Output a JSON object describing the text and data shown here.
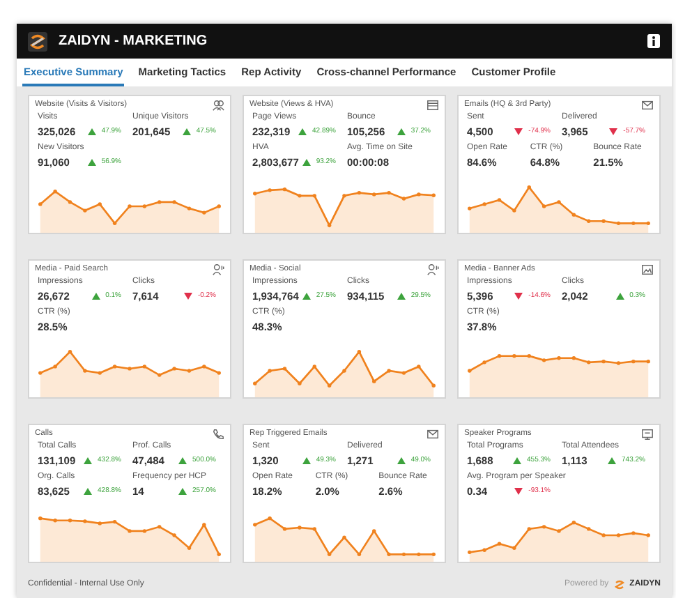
{
  "header": {
    "title": "ZAIDYN - MARKETING"
  },
  "tabs": [
    {
      "label": "Executive Summary",
      "selected": true
    },
    {
      "label": "Marketing Tactics",
      "selected": false
    },
    {
      "label": "Rep Activity",
      "selected": false
    },
    {
      "label": "Cross-channel Performance",
      "selected": false
    },
    {
      "label": "Customer Profile",
      "selected": false
    }
  ],
  "cards": [
    {
      "title": "Website (Visits & Visitors)",
      "rows": [
        {
          "metrics": [
            {
              "label": "Visits",
              "value": "325,026",
              "delta": "47.9%",
              "rising": true
            },
            {
              "label": "Unique Visitors",
              "value": "201,645",
              "delta": "47.5%",
              "rising": true
            }
          ]
        },
        {
          "metrics": [
            {
              "label": "New Visitors",
              "value": "91,060",
              "delta": "56.9%",
              "rising": true
            }
          ]
        }
      ]
    },
    {
      "title": "Website (Views & HVA)",
      "rows": [
        {
          "metrics": [
            {
              "label": "Page Views",
              "value": "232,319",
              "delta": "42.89%",
              "rising": true
            },
            {
              "label": "Bounce",
              "value": "105,256",
              "delta": "37.2%",
              "rising": true
            }
          ]
        },
        {
          "metrics": [
            {
              "label": "HVA",
              "value": "2,803,677",
              "delta": "93.2%",
              "rising": true
            },
            {
              "label": "Avg. Time on Site",
              "value": "00:00:08"
            }
          ]
        }
      ]
    },
    {
      "title": "Emails (HQ & 3rd Party)",
      "rows": [
        {
          "metrics": [
            {
              "label": "Sent",
              "value": "4,500",
              "delta": "-74.9%",
              "rising": false
            },
            {
              "label": "Delivered",
              "value": "3,965",
              "delta": "-57.7%",
              "rising": false
            }
          ]
        },
        {
          "metrics": [
            {
              "label": "Open Rate",
              "value": "84.6%"
            },
            {
              "label": "CTR (%)",
              "value": "64.8%"
            },
            {
              "label": "Bounce Rate",
              "value": "21.5%"
            }
          ]
        }
      ]
    },
    {
      "title": "Media - Paid Search",
      "rows": [
        {
          "metrics": [
            {
              "label": "Impressions",
              "value": "26,672",
              "delta": "0.1%",
              "rising": true
            },
            {
              "label": "Clicks",
              "value": "7,614",
              "delta": "-0.2%",
              "rising": false
            }
          ]
        },
        {
          "metrics": [
            {
              "label": "CTR (%)",
              "value": "28.5%"
            }
          ]
        }
      ]
    },
    {
      "title": "Media - Social",
      "rows": [
        {
          "metrics": [
            {
              "label": "Impressions",
              "value": "1,934,764",
              "delta": "27.5%",
              "rising": true
            },
            {
              "label": "Clicks",
              "value": "934,115",
              "delta": "29.5%",
              "rising": true
            }
          ]
        },
        {
          "metrics": [
            {
              "label": "CTR (%)",
              "value": "48.3%"
            }
          ]
        }
      ]
    },
    {
      "title": "Media - Banner Ads",
      "rows": [
        {
          "metrics": [
            {
              "label": "Impressions",
              "value": "5,396",
              "delta": "-14.6%",
              "rising": false
            },
            {
              "label": "Clicks",
              "value": "2,042",
              "delta": "0.3%",
              "rising": true
            }
          ]
        },
        {
          "metrics": [
            {
              "label": "CTR (%)",
              "value": "37.8%"
            }
          ]
        }
      ]
    },
    {
      "title": "Calls",
      "rows": [
        {
          "metrics": [
            {
              "label": "Total Calls",
              "value": "131,109",
              "delta": "432.8%",
              "rising": true
            },
            {
              "label": "Prof. Calls",
              "value": "47,484",
              "delta": "500.0%",
              "rising": true
            }
          ]
        },
        {
          "metrics": [
            {
              "label": "Org. Calls",
              "value": "83,625",
              "delta": "428.8%",
              "rising": true
            },
            {
              "label": "Frequency per HCP",
              "value": "14",
              "delta": "257.0%",
              "rising": true
            }
          ]
        }
      ]
    },
    {
      "title": "Rep Triggered Emails",
      "rows": [
        {
          "metrics": [
            {
              "label": "Sent",
              "value": "1,320",
              "delta": "49.3%",
              "rising": true
            },
            {
              "label": "Delivered",
              "value": "1,271",
              "delta": "49.0%",
              "rising": true
            }
          ]
        },
        {
          "metrics": [
            {
              "label": "Open Rate",
              "value": "18.2%"
            },
            {
              "label": "CTR (%)",
              "value": "2.0%"
            },
            {
              "label": "Bounce Rate",
              "value": "2.6%"
            }
          ]
        }
      ]
    },
    {
      "title": "Speaker Programs",
      "rows": [
        {
          "metrics": [
            {
              "label": "Total Programs",
              "value": "1,688",
              "delta": "455.3%",
              "rising": true
            },
            {
              "label": "Total Attendees",
              "value": "1,113",
              "delta": "743.2%",
              "rising": true
            }
          ]
        },
        {
          "metrics": [
            {
              "label": "Avg. Program per Speaker",
              "value": "0.34",
              "delta": "-93.1%",
              "rising": false
            }
          ]
        }
      ]
    }
  ],
  "footer": {
    "note": "Confidential - Internal Use Only",
    "powered_by": "Powered by",
    "brand": "ZAIDYN"
  }
}
